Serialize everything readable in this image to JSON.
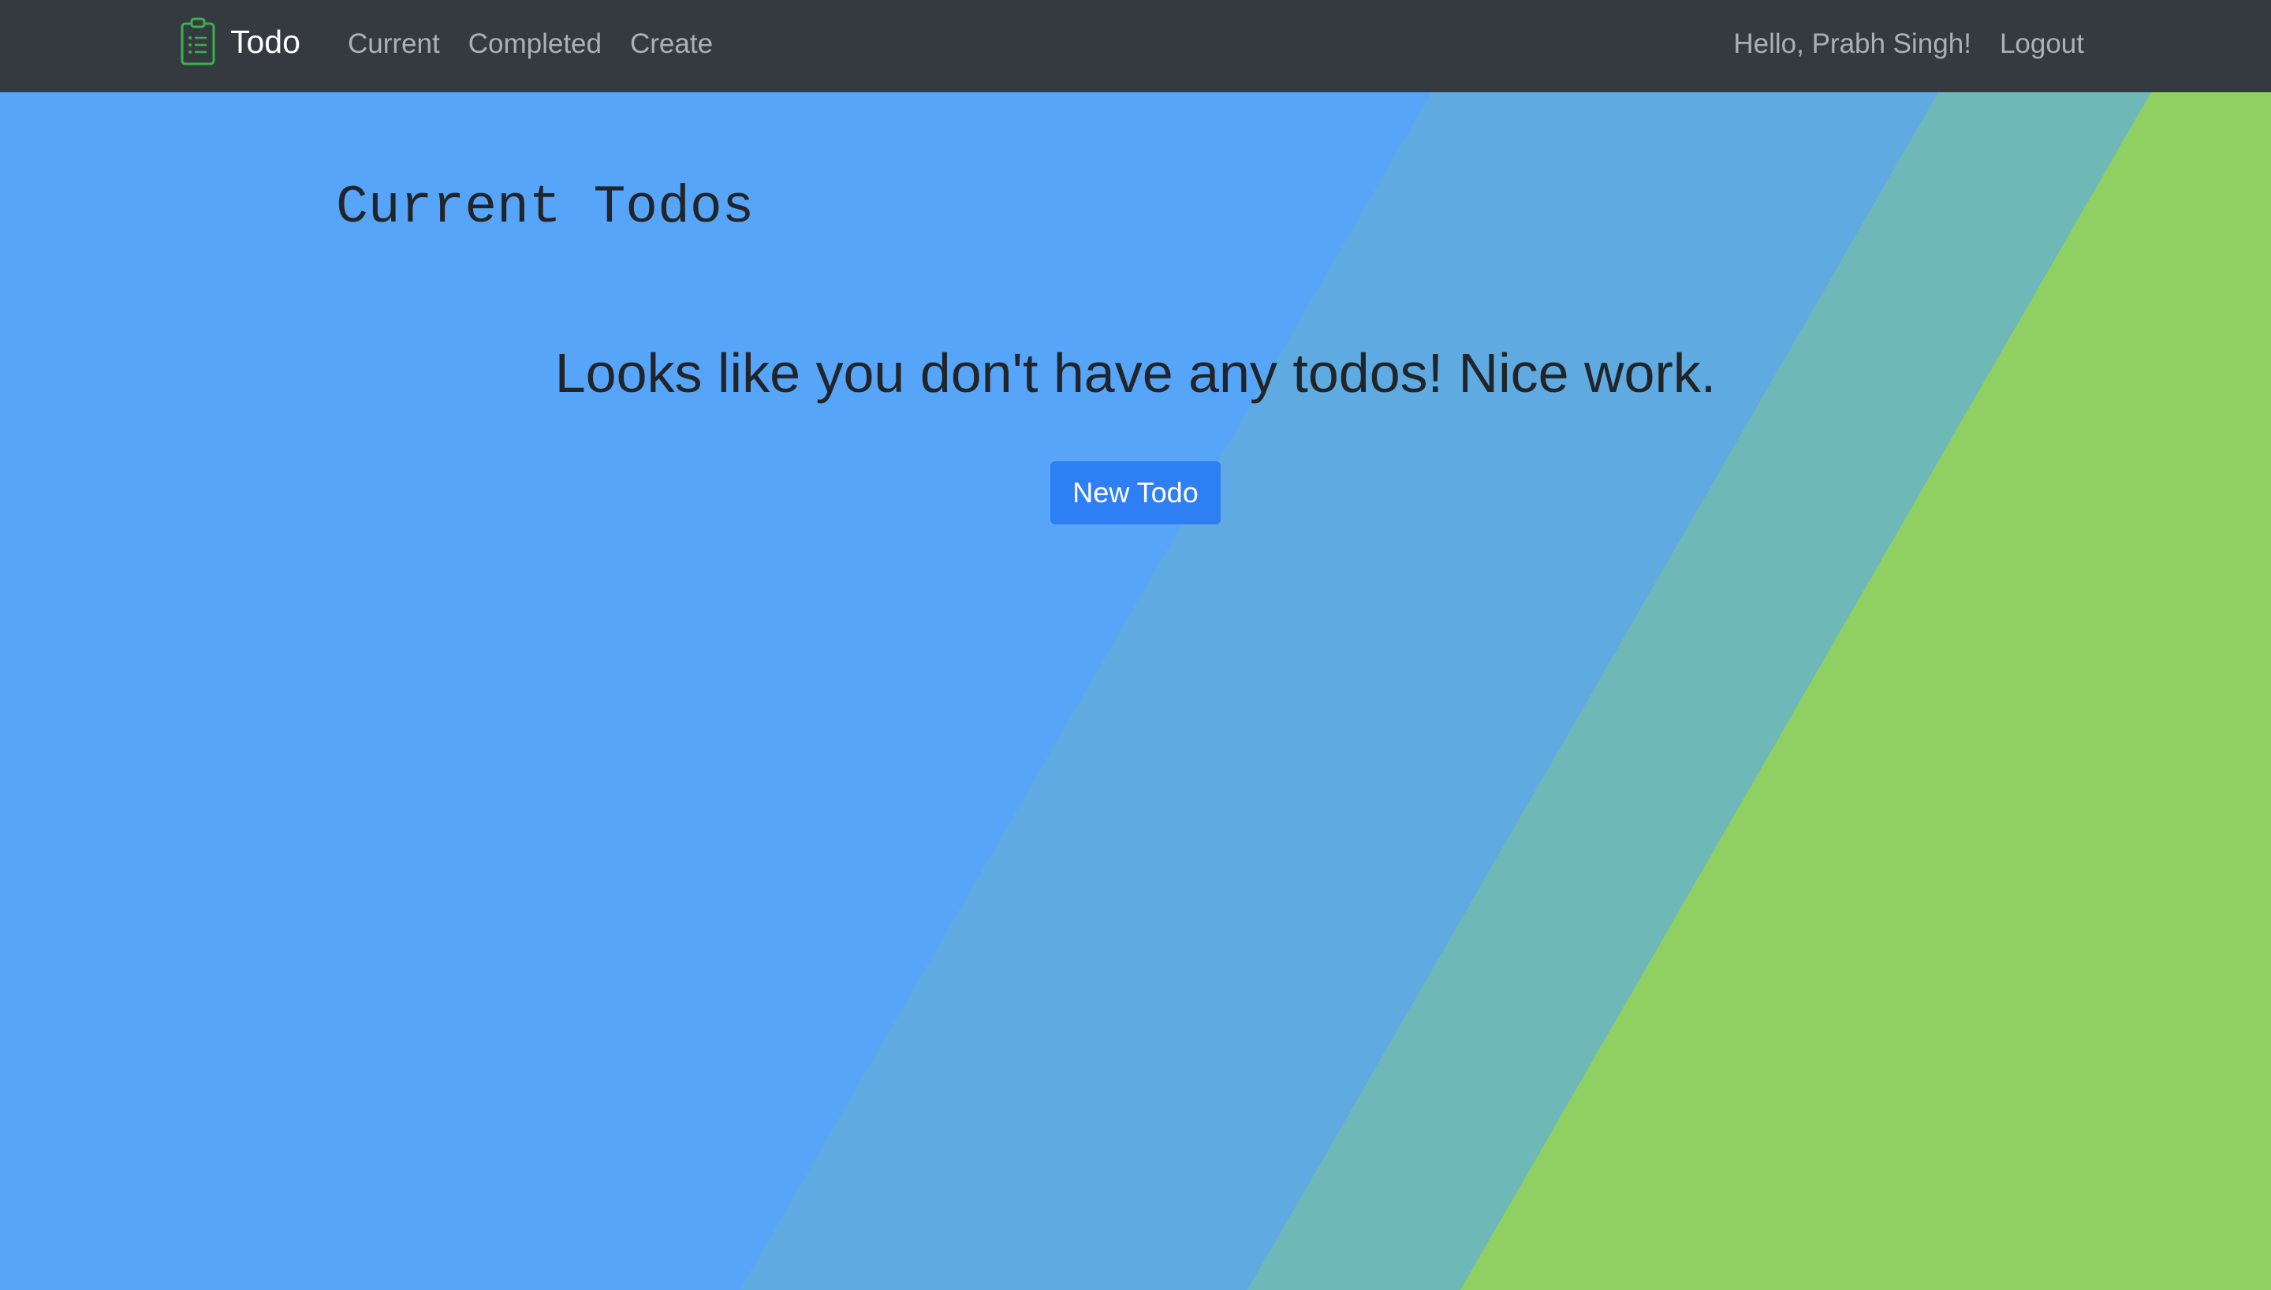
{
  "navbar": {
    "brand_icon": "clipboard-list-icon",
    "brand_label": "Todo",
    "links": {
      "current": "Current",
      "completed": "Completed",
      "create": "Create"
    },
    "greeting": "Hello, Prabh Singh!",
    "logout": "Logout"
  },
  "main": {
    "heading": "Current Todos",
    "empty_message": "Looks like you don't have any todos! Nice work.",
    "new_todo_button": "New Todo"
  },
  "colors": {
    "navbar_bg": "#343a40",
    "bg_blue": "#56a5f8",
    "bg_stripe_1": "#5faae0",
    "bg_stripe_2": "#6fb8b8",
    "bg_green": "#90d062",
    "button": "#2f7ff4",
    "brand_icon": "#3cb04a"
  }
}
